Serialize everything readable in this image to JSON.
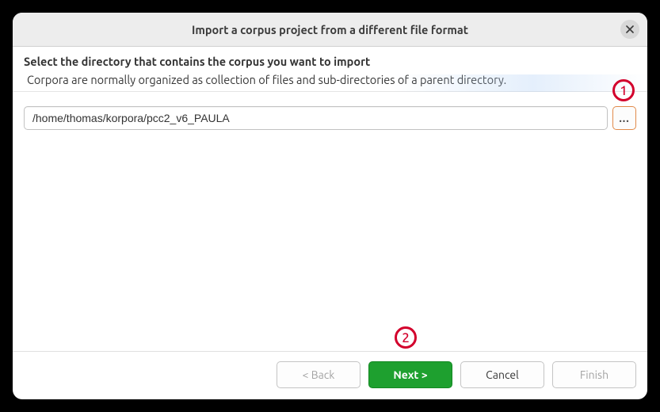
{
  "dialog": {
    "title": "Import a corpus project from a different file format",
    "heading": "Select the directory that contains the corpus you want to import",
    "subtext": "Corpora are normally organized as collection of files and sub-directories of a parent directory."
  },
  "path": {
    "value": "/home/thomas/korpora/pcc2_v6_PAULA",
    "browse_label": "..."
  },
  "buttons": {
    "back": "< Back",
    "next": "Next >",
    "cancel": "Cancel",
    "finish": "Finish"
  },
  "callouts": {
    "c1": "1",
    "c2": "2"
  }
}
